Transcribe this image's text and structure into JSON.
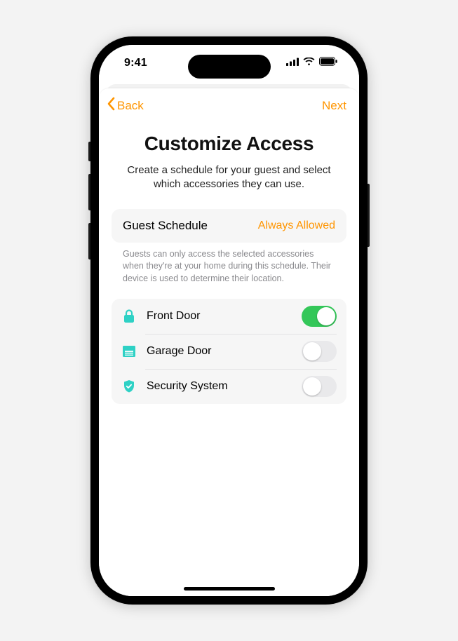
{
  "status": {
    "time": "9:41"
  },
  "nav": {
    "back_label": "Back",
    "next_label": "Next"
  },
  "header": {
    "title": "Customize Access",
    "subtitle": "Create a schedule for your guest and select which accessories they can use."
  },
  "schedule": {
    "label": "Guest Schedule",
    "value": "Always Allowed",
    "caption": "Guests can only access the selected accessories when they're at your home during this schedule. Their device is used to determine their location."
  },
  "accessories": [
    {
      "icon": "lock-icon",
      "label": "Front Door",
      "on": true
    },
    {
      "icon": "garage-icon",
      "label": "Garage Door",
      "on": false
    },
    {
      "icon": "shield-icon",
      "label": "Security System",
      "on": false
    }
  ],
  "colors": {
    "accent": "#ff9500",
    "teal": "#30d5c8",
    "green": "#34c759"
  }
}
